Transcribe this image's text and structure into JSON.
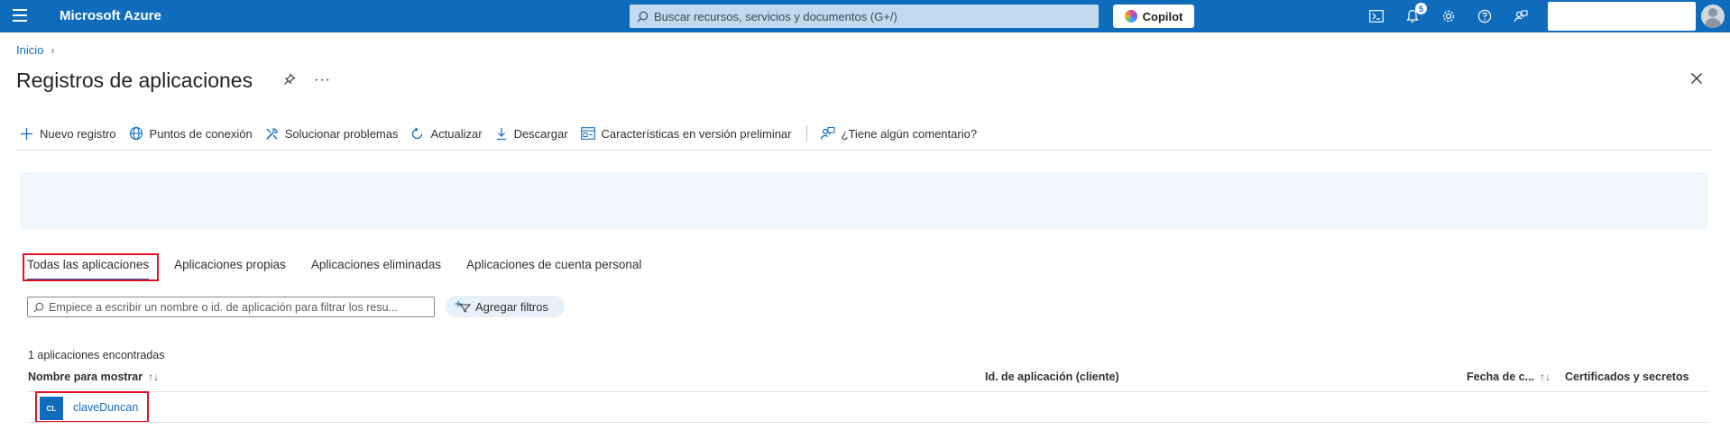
{
  "topbar": {
    "brand": "Microsoft Azure",
    "search_placeholder": "Buscar recursos, servicios y documentos (G+/)",
    "copilot_label": "Copilot",
    "notification_count": "5",
    "accent_color": "#0f6cbd",
    "icons": [
      "hamburger-icon",
      "cloud-shell-icon",
      "bell-icon",
      "gear-icon",
      "help-icon",
      "feedback-icon"
    ]
  },
  "breadcrumb": {
    "home": "Inicio"
  },
  "page": {
    "title": "Registros de aplicaciones",
    "more": "···"
  },
  "toolbar": {
    "new_registration": "Nuevo registro",
    "endpoints": "Puntos de conexión",
    "troubleshoot": "Solucionar problemas",
    "refresh": "Actualizar",
    "download": "Descargar",
    "preview_features": "Características en versión preliminar",
    "feedback": "¿Tiene algún comentario?"
  },
  "tabs": [
    {
      "label": "Todas las aplicaciones",
      "active": true
    },
    {
      "label": "Aplicaciones propias",
      "active": false
    },
    {
      "label": "Aplicaciones eliminadas",
      "active": false
    },
    {
      "label": "Aplicaciones de cuenta personal",
      "active": false
    }
  ],
  "filter": {
    "placeholder": "Empiece a escribir un nombre o id. de aplicación para filtrar los resu...",
    "add_filters": "Agregar filtros"
  },
  "results": {
    "count_text": "1 aplicaciones encontradas"
  },
  "table": {
    "columns": {
      "display_name": "Nombre para mostrar",
      "app_id": "Id. de aplicación (cliente)",
      "created": "Fecha de c...",
      "certs": "Certificados y secretos"
    },
    "rows": [
      {
        "initials": "CL",
        "name": "claveDuncan"
      }
    ]
  }
}
